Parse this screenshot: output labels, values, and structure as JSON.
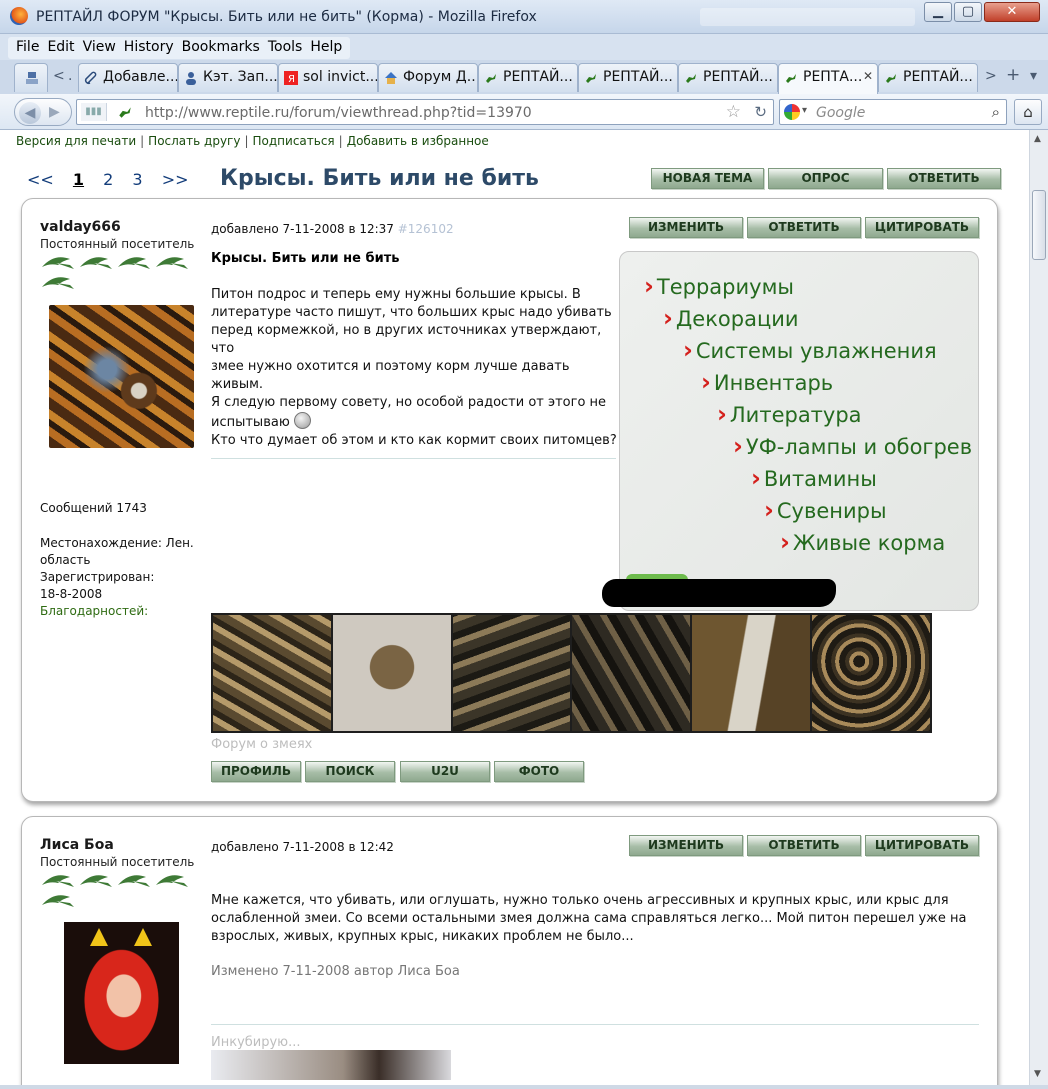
{
  "window": {
    "title": "РЕПТАЙЛ ФОРУМ \"Крысы. Бить или не бить\" (Корма) - Mozilla Firefox",
    "min": "▁",
    "max": "▢",
    "close": "✕"
  },
  "menu": [
    "File",
    "Edit",
    "View",
    "History",
    "Bookmarks",
    "Tools",
    "Help"
  ],
  "tabs": [
    {
      "label": "Добавле...",
      "icon": "paperclip-icon"
    },
    {
      "label": "Кэт. Зап...",
      "icon": "person-icon"
    },
    {
      "label": "sol invict...",
      "icon": "yandex-icon"
    },
    {
      "label": "Форум Д...",
      "icon": "house-icon"
    },
    {
      "label": "РЕПТАЙ...",
      "icon": "lizard-icon"
    },
    {
      "label": "РЕПТАЙ...",
      "icon": "lizard-icon"
    },
    {
      "label": "РЕПТАЙ...",
      "icon": "lizard-icon"
    },
    {
      "label": "РЕПТА...",
      "icon": "lizard-icon",
      "active": true
    },
    {
      "label": "РЕПТАЙ...",
      "icon": "lizard-icon"
    }
  ],
  "tab_nav": {
    "left": "<",
    "dot": ".",
    "right": ">",
    "new": "+",
    "list": "▾"
  },
  "nav": {
    "url": "http://www.reptile.ru/forum/viewthread.php?tid=13970",
    "search_placeholder": "Google"
  },
  "toplinks": [
    "Версия для печати",
    "Послать другу",
    "Подписаться",
    "Добавить в избранное"
  ],
  "pager": {
    "first": "<<",
    "pages": [
      "1",
      "2",
      "3"
    ],
    "current": "1",
    "last": ">>"
  },
  "thread_title": "Крысы. Бить или не бить",
  "thread_buttons": {
    "new_topic": "НОВАЯ ТЕМА",
    "poll": "ОПРОС",
    "reply": "ОТВЕТИТЬ"
  },
  "post_buttons": {
    "edit": "ИЗМЕНИТЬ",
    "reply": "ОТВЕТИТЬ",
    "quote": "ЦИТИРОВАТЬ"
  },
  "profile_buttons": {
    "profile": "ПРОФИЛЬ",
    "search": "ПОИСК",
    "u2u": "U2U",
    "photo": "ФОТО"
  },
  "posts": [
    {
      "author": "valday666",
      "rank": "Постоянный посетитель",
      "messages": "Сообщений 1743",
      "location_label": "Местонахождение: Лен.",
      "location_cont": "область",
      "registered_label": "Зарегистрирован:",
      "registered_date": "18-8-2008",
      "thanks": "Благодарностей:",
      "date": "добавлено 7-11-2008 в 12:37",
      "post_id": "#126102",
      "subject": "Крысы. Бить или не бить",
      "body_lines": [
        "Питон подрос и теперь ему нужны большие крысы. В",
        "литературе часто пишут, что больших крыс надо убивать",
        "перед кормежкой, но в других источниках утверждают, что",
        "змее нужно охотится и поэтому корм лучше давать живым.",
        "Я следую первому совету, но особой радости от этого не",
        "испытываю"
      ],
      "body_last": "Кто что думает об этом и кто как кормит своих питомцев?",
      "signature": "Форум о змеях"
    },
    {
      "author": "Лиса Боа",
      "rank": "Постоянный посетитель",
      "date": "добавлено 7-11-2008 в 12:42",
      "body_lines": [
        "Мне кажется, что убивать, или оглушать, нужно только очень агрессивных и крупных крыс, или крыс для",
        "ослабленной змеи. Со всеми остальными змея должна сама справляться легко... Мой питон перешел уже на",
        "взрослых, живых, крупных крыс, никаких проблем не было..."
      ],
      "edited": "Изменено 7-11-2008 автор Лиса Боа",
      "signature": "Инкубирую..."
    }
  ],
  "ad_menu": [
    "Террариумы",
    "Декорации",
    "Системы увлажнения",
    "Инвентарь",
    "Литература",
    "УФ-лампы и обогрев",
    "Витамины",
    "Сувениры",
    "Живые корма"
  ],
  "colors": {
    "link_green": "#1a4d0f",
    "title_blue": "#2d4a68",
    "button_green": "#a7bda7",
    "ad_red": "#d4201c",
    "ad_green": "#256a1f"
  }
}
